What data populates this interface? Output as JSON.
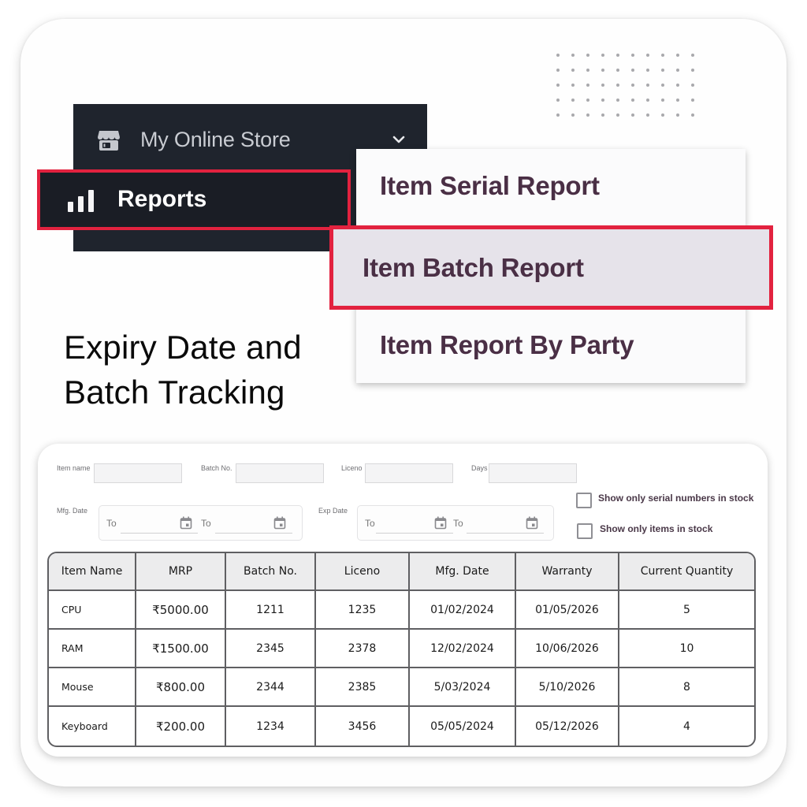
{
  "nav": {
    "store_label": "My Online Store",
    "store_icon": "store-icon",
    "chevron_icon": "chevron-down-icon",
    "reports_label": "Reports",
    "reports_icon": "bar-chart-icon",
    "highlight_color": "#e2223f",
    "panel_color": "#1f242d"
  },
  "dropdown": {
    "items": [
      {
        "label": "Item Serial Report",
        "selected": false
      },
      {
        "label": "Item Batch Report",
        "selected": true
      },
      {
        "label": "Item Report By Party",
        "selected": false
      }
    ],
    "text_color": "#4a2f45"
  },
  "headline": {
    "line1": "Expiry Date and",
    "line2": "Batch Tracking"
  },
  "filters": {
    "item_name": {
      "label": "Item name",
      "value": ""
    },
    "batch_no": {
      "label": "Batch No.",
      "value": ""
    },
    "liceno": {
      "label": "Liceno",
      "value": ""
    },
    "days": {
      "label": "Days",
      "value": ""
    },
    "mfg_date": {
      "label": "Mfg. Date",
      "from_label": "To",
      "to_label": "To",
      "from_value": "",
      "to_value": ""
    },
    "exp_date": {
      "label": "Exp Date",
      "from_label": "To",
      "to_label": "To",
      "from_value": "",
      "to_value": ""
    },
    "checkboxes": [
      {
        "label": "Show only serial numbers in stock",
        "checked": false
      },
      {
        "label": "Show only items in stock",
        "checked": false
      }
    ]
  },
  "table": {
    "headers": [
      "Item Name",
      "MRP",
      "Batch No.",
      "Liceno",
      "Mfg. Date",
      "Warranty",
      "Current Quantity"
    ],
    "rows": [
      [
        "CPU",
        "₹5000.00",
        "1211",
        "1235",
        "01/02/2024",
        "01/05/2026",
        "5"
      ],
      [
        "RAM",
        "₹1500.00",
        "2345",
        "2378",
        "12/02/2024",
        "10/06/2026",
        "10"
      ],
      [
        "Mouse",
        "₹800.00",
        "2344",
        "2385",
        "5/03/2024",
        "5/10/2026",
        "8"
      ],
      [
        "Keyboard",
        "₹200.00",
        "1234",
        "3456",
        "05/05/2024",
        "05/12/2026",
        "4"
      ]
    ]
  }
}
